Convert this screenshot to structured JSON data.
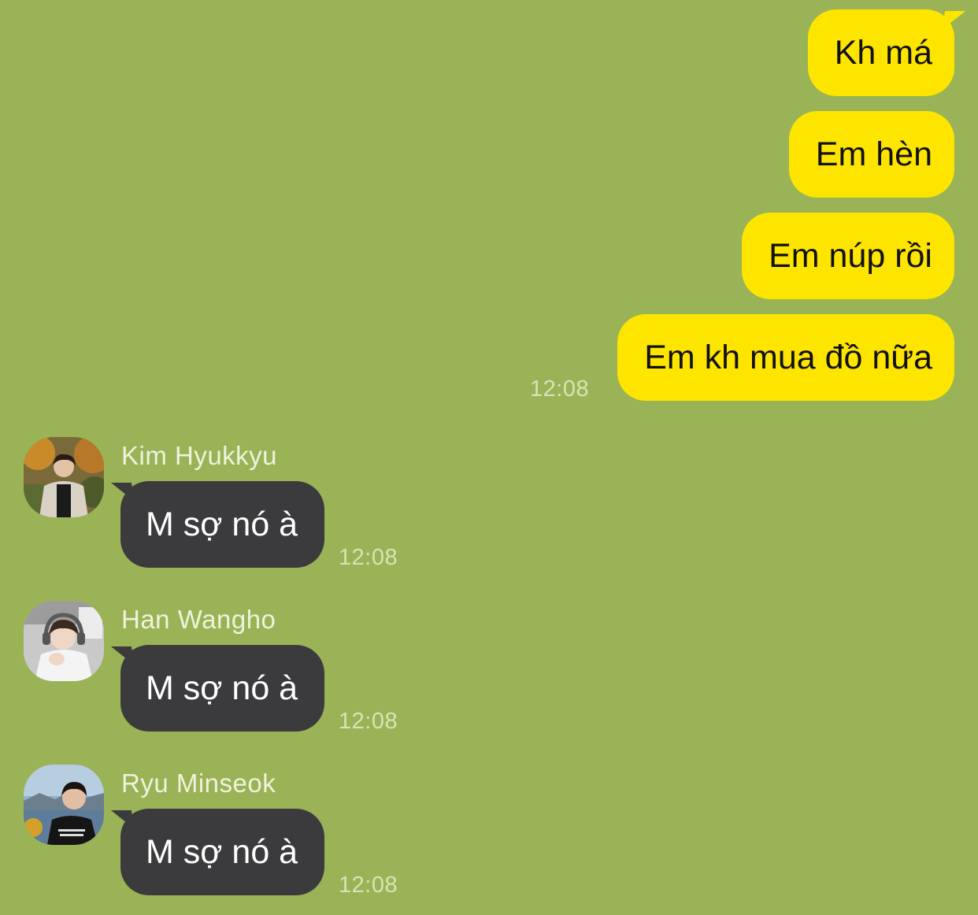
{
  "outgoing": {
    "messages": [
      "Kh má",
      "Em hèn",
      "Em núp rồi",
      "Em kh mua đồ nữa"
    ],
    "time": "12:08"
  },
  "incoming": [
    {
      "sender": "Kim Hyukkyu",
      "text": "M sợ nó à",
      "time": "12:08"
    },
    {
      "sender": "Han Wangho",
      "text": "M sợ nó à",
      "time": "12:08"
    },
    {
      "sender": "Ryu Minseok",
      "text": "M sợ nó à",
      "time": "12:08"
    }
  ],
  "colors": {
    "background": "#9ab356",
    "outgoing_bubble": "#fee500",
    "incoming_bubble": "#3b3b3d"
  }
}
